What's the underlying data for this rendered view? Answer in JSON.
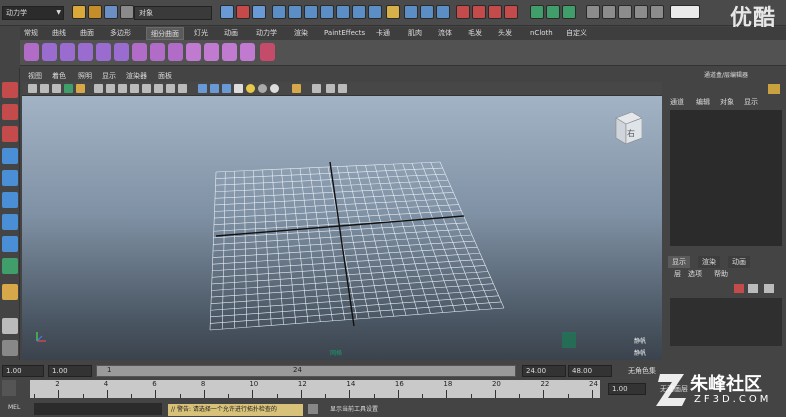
{
  "status_line": {
    "mode": "动力学",
    "object_field": "对象",
    "watermark_top": "优酷"
  },
  "shelf_tabs": [
    "常规",
    "曲线",
    "曲面",
    "多边形",
    "细分曲面",
    "灯光",
    "动画",
    "动力学",
    "渲染",
    "PaintEffects",
    "卡通",
    "肌肉",
    "流体",
    "毛发",
    "头发",
    "nCloth",
    "自定义"
  ],
  "shelf_active": "细分曲面",
  "panel_menu": [
    "视图",
    "着色",
    "照明",
    "显示",
    "渲染器",
    "面板"
  ],
  "viewport": {
    "viewcube_label": "右",
    "bottom_label_1": "静帆",
    "bottom_label_2": "静帆",
    "grid_label": "网格",
    "accent_color": "#1a9a6a"
  },
  "channel_box": {
    "title": "通道盒/层编辑器",
    "menu": [
      "通道",
      "编辑",
      "对象",
      "显示"
    ],
    "layer_tabs": [
      "显示",
      "渲染",
      "动画"
    ],
    "layer_menu": [
      "层",
      "选项",
      "帮助"
    ]
  },
  "range": {
    "start": "1.00",
    "start_inner": "1.00",
    "range_marker_1": "1",
    "range_marker_24": "24",
    "end_inner": "24.00",
    "end": "48.00",
    "char_set": "无角色集"
  },
  "time_slider": {
    "ticks": [
      "2",
      "4",
      "6",
      "8",
      "10",
      "12",
      "14",
      "16",
      "18",
      "20",
      "22",
      "24"
    ],
    "current": "1.00",
    "anim_layer": "无动画层"
  },
  "command_line": {
    "label": "MEL",
    "warning": "// 警告: 请选择一个允许进行拓扑检查的",
    "help": "显示当前工具设置"
  },
  "watermark_bottom": {
    "name": "朱峰社区",
    "url": "ZF3D.COM"
  }
}
